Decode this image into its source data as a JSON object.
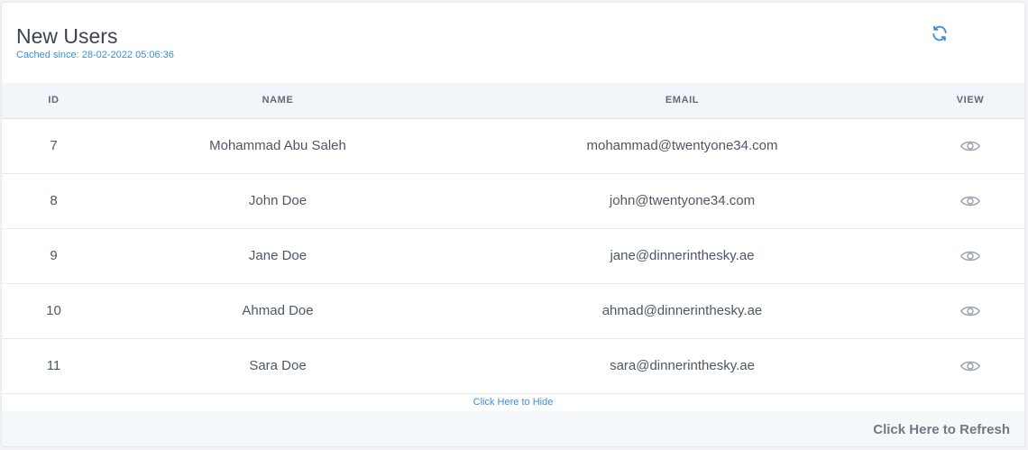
{
  "header": {
    "title": "New Users",
    "cached_label": "Cached since: 28-02-2022 05:06:36",
    "refresh_icon": "refresh-icon"
  },
  "table": {
    "columns": [
      "ID",
      "NAME",
      "EMAIL",
      "VIEW"
    ],
    "rows": [
      {
        "id": "7",
        "name": "Mohammad Abu Saleh",
        "email": "mohammad@twentyone34.com"
      },
      {
        "id": "8",
        "name": "John Doe",
        "email": "john@twentyone34.com"
      },
      {
        "id": "9",
        "name": "Jane Doe",
        "email": "jane@dinnerinthesky.ae"
      },
      {
        "id": "10",
        "name": "Ahmad Doe",
        "email": "ahmad@dinnerinthesky.ae"
      },
      {
        "id": "11",
        "name": "Sara Doe",
        "email": "sara@dinnerinthesky.ae"
      }
    ],
    "view_icon": "eye-icon"
  },
  "hide_link": "Click Here to Hide",
  "footer": {
    "refresh_link": "Click Here to Refresh"
  },
  "colors": {
    "accent": "#3a8fd9",
    "title": "#3b4350",
    "header_bg": "#f2f6fa",
    "footer_bg": "#f4f8fb",
    "icon_gray": "#9aa3ad"
  }
}
